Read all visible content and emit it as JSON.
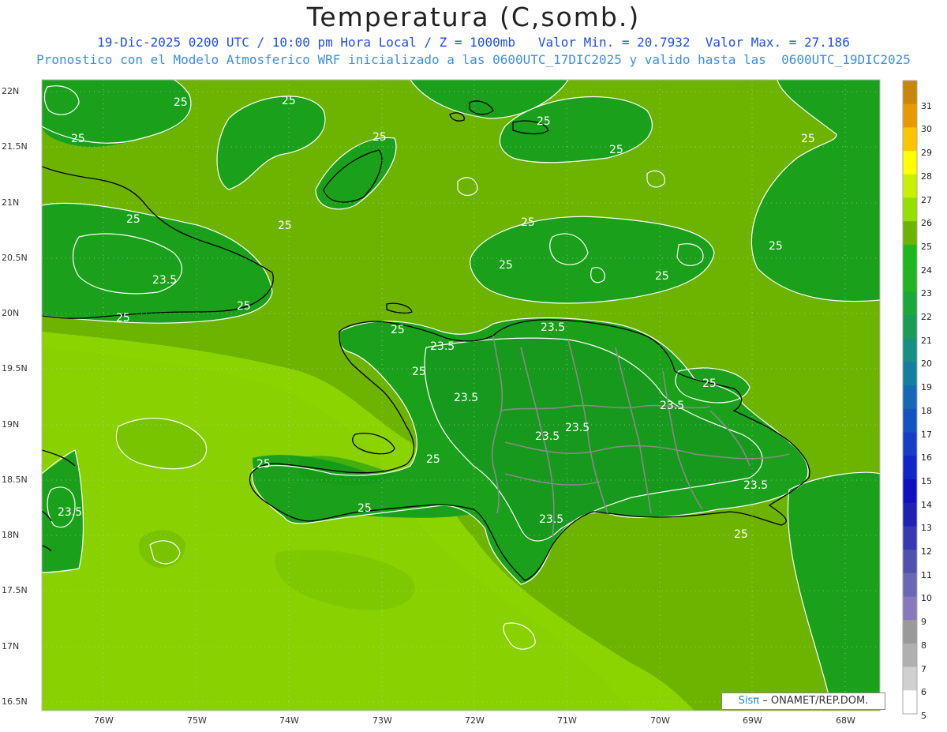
{
  "map": {
    "title": "Temperatura (C,somb.)",
    "subtitle_line1": "19-Dic-2025 0200 UTC / 10:00 pm Hora Local / Z = 1000mb   Valor Min. = 20.7932  Valor Max. = 27.186",
    "subtitle_line2": "Pronostico con el Modelo Atmosferico WRF inicializado a las 0600UTC_17DIC2025 y valido hasta las  0600UTC_19DIC2025",
    "lat_labels": [
      "22N",
      "21.5N",
      "21N",
      "20.5N",
      "20N",
      "19.5N",
      "19N",
      "18.5N",
      "18N",
      "17.5N",
      "17N",
      "16.5N"
    ],
    "lon_labels": [
      "76W",
      "75W",
      "74W",
      "73W",
      "72W",
      "71W",
      "70W",
      "69W",
      "68W"
    ],
    "contour_labels": [
      "25",
      "25",
      "25",
      "25",
      "25",
      "25",
      "25",
      "25",
      "25",
      "25",
      "25",
      "25",
      "25",
      "25",
      "25",
      "25",
      "25",
      "25",
      "25",
      "25",
      "25",
      "25",
      "23.5",
      "23.5",
      "23.5",
      "23.5",
      "23.5",
      "23.5",
      "23.5",
      "23.5",
      "23.5",
      "23.5"
    ],
    "colorbar": {
      "labels": [
        "31",
        "30",
        "29",
        "28",
        "27",
        "26",
        "25",
        "24",
        "23",
        "22",
        "21",
        "20",
        "19",
        "18",
        "17",
        "16",
        "15",
        "14",
        "13",
        "12",
        "11",
        "10",
        "9",
        "8",
        "7",
        "6",
        "5"
      ],
      "colors": [
        "#c8860a",
        "#e69a00",
        "#ffc400",
        "#ffff00",
        "#c8f000",
        "#96e000",
        "#6cb400",
        "#1cb81c",
        "#22b422",
        "#1ba83a",
        "#189c58",
        "#169080",
        "#147ea0",
        "#1468b4",
        "#1454c0",
        "#143ec4",
        "#1026c8",
        "#1010c0",
        "#2020b4",
        "#3838b0",
        "#5050b0",
        "#6868b4",
        "#8878bc",
        "#9a9a9a",
        "#b0b0b0",
        "#d0d0d0",
        "#ffffff"
      ]
    },
    "credit_brand": "Sisπ",
    "credit_text": "– ONAMET/REP.DOM.",
    "colors": {
      "sea_dark": "#6cb400",
      "sea_light": "#8cd400",
      "land": "#1aa01a",
      "contour": "#ffffff",
      "coast": "#000000",
      "borders": "#8a8a8a"
    }
  }
}
